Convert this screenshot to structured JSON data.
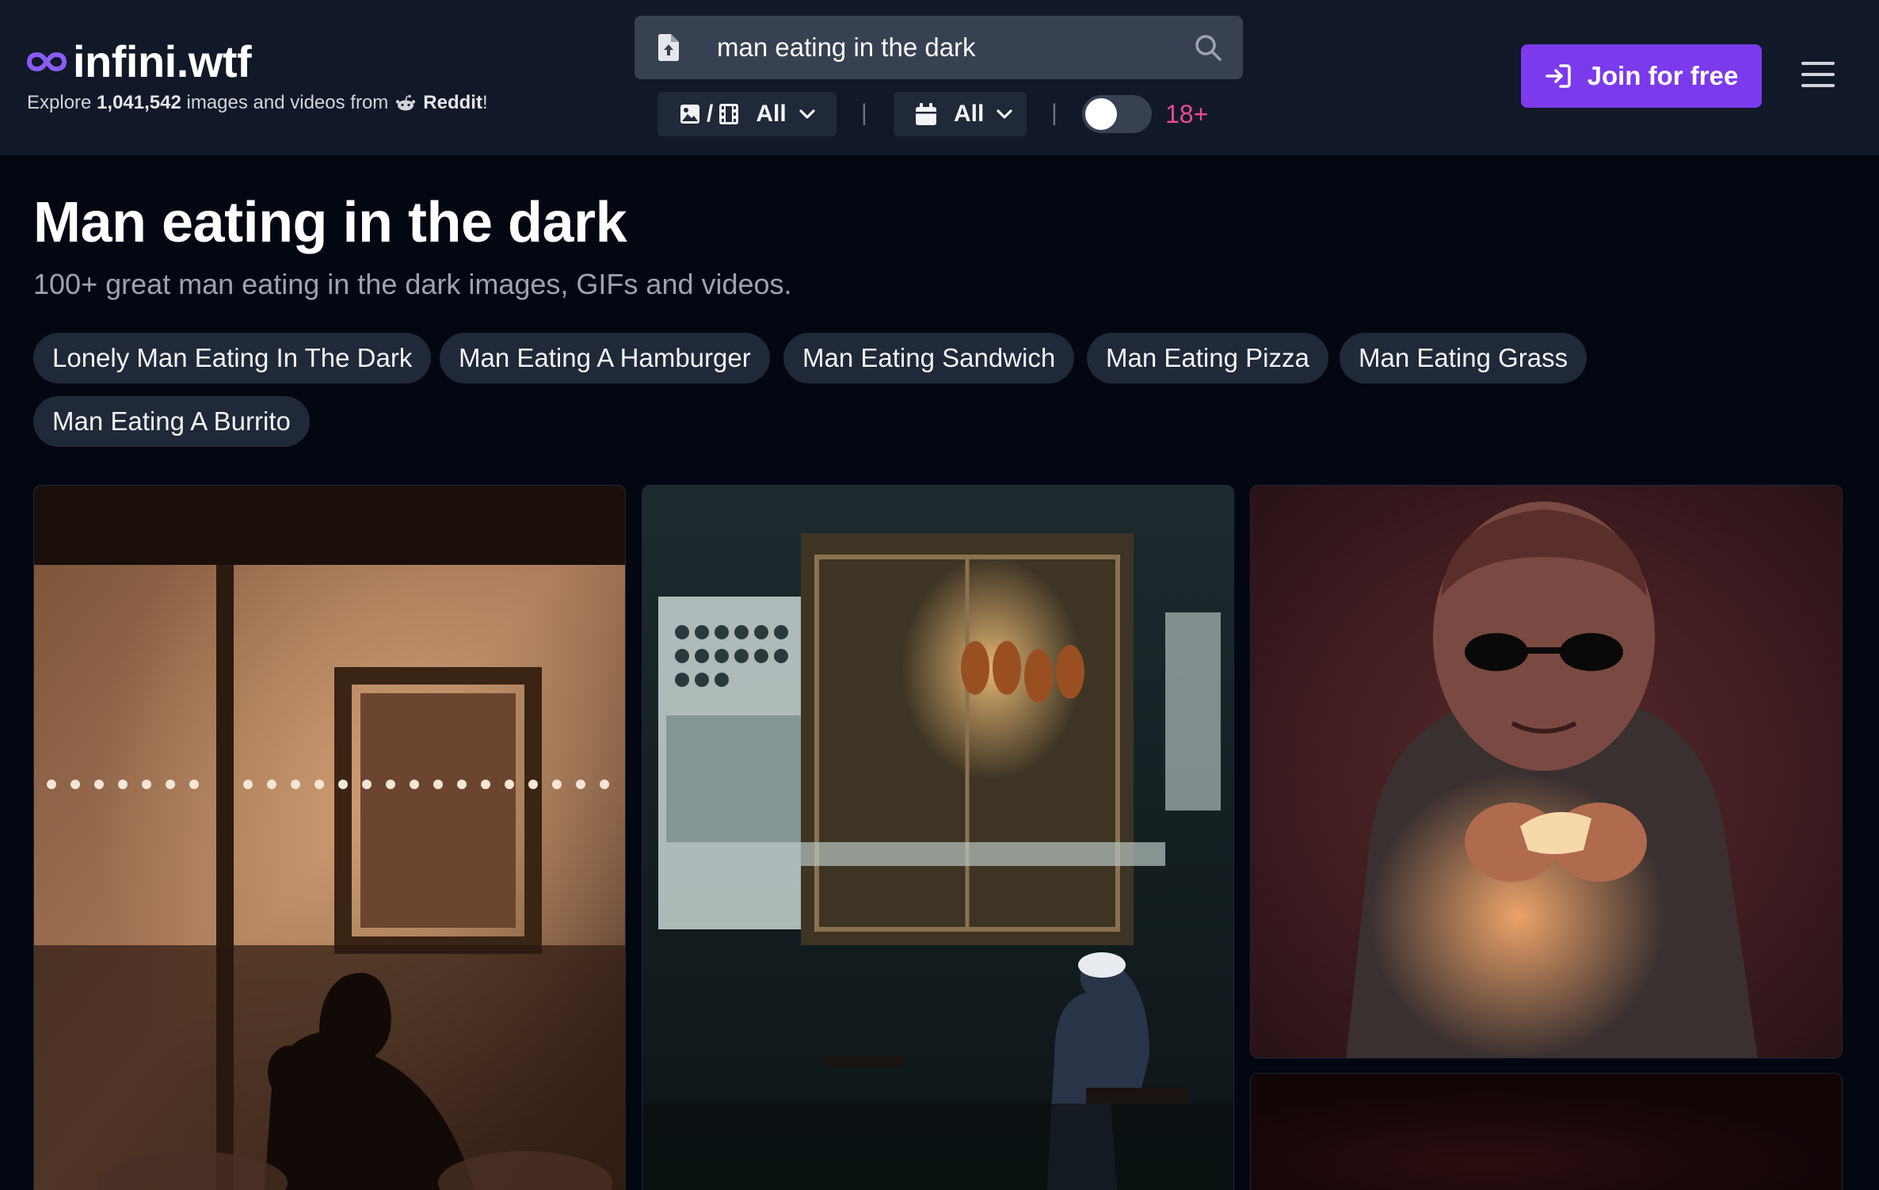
{
  "brand": {
    "name": "infini.wtf",
    "tagline_prefix": "Explore",
    "count": "1,041,542",
    "tagline_middle": "images and videos from",
    "source": "Reddit",
    "tagline_suffix": "!"
  },
  "search": {
    "value": "man eating in the dark",
    "placeholder": "Search"
  },
  "filters": {
    "media_separator": "/",
    "media_type": "All",
    "date_range": "All",
    "divider": "|",
    "nsfw_label": "18+",
    "nsfw_enabled": false
  },
  "header": {
    "join_label": "Join for free"
  },
  "main": {
    "title": "Man eating in the dark",
    "subtitle": "100+ great man eating in the dark images, GIFs and videos.",
    "tags": [
      "Lonely Man Eating In The Dark",
      "Man Eating A Hamburger",
      "Man Eating Sandwich",
      "Man Eating Pizza",
      "Man Eating Grass",
      "Man Eating A Burrito"
    ]
  },
  "colors": {
    "background": "#030712",
    "header": "#111827",
    "accent": "#7c3aed",
    "nsfw": "#ec4899",
    "chip": "#1f2937"
  },
  "icons": {
    "logo": "infinity-icon",
    "source": "reddit-icon",
    "upload": "file-upload-icon",
    "search": "search-icon",
    "media": [
      "image-icon",
      "film-icon"
    ],
    "date": "calendar-icon",
    "join": "sign-in-icon",
    "menu": "hamburger-menu-icon"
  }
}
